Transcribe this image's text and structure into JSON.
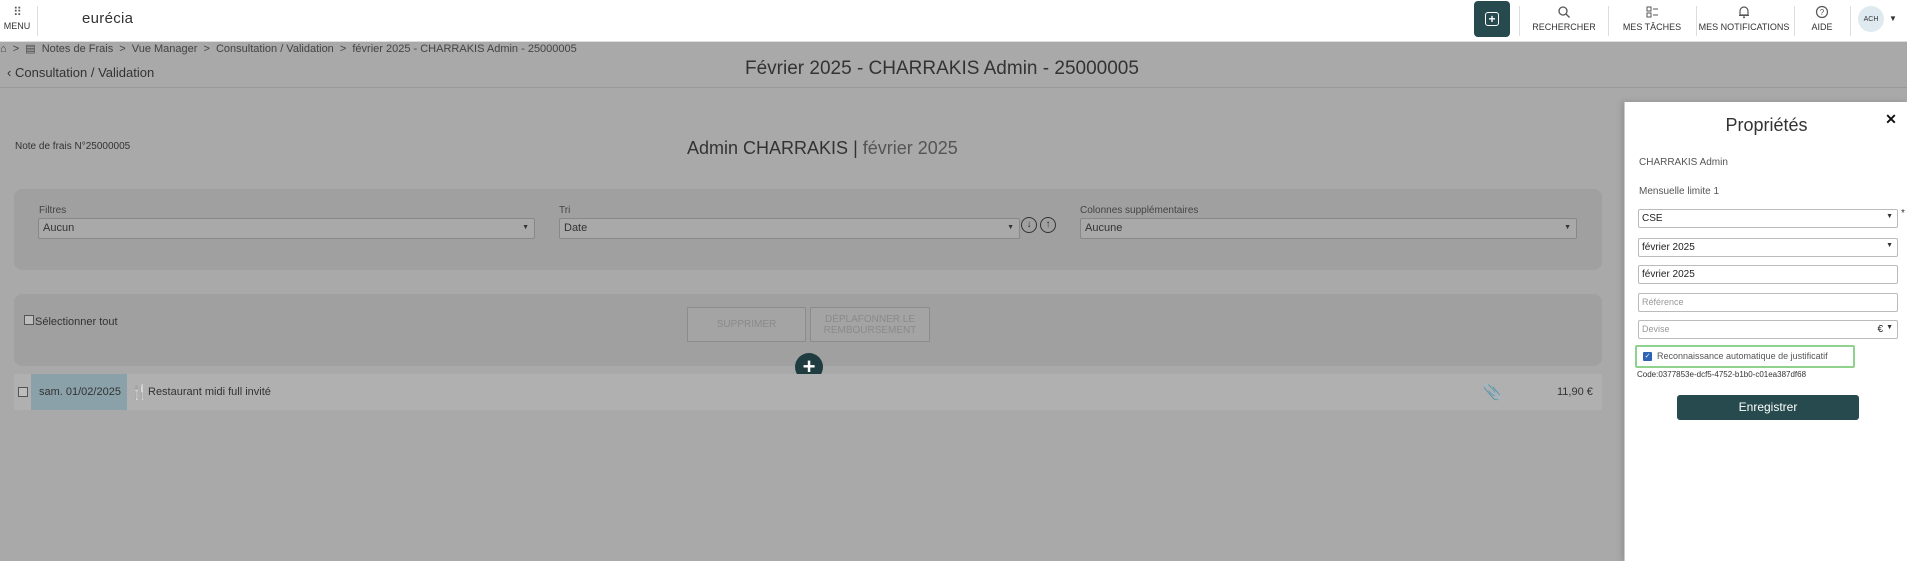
{
  "topbar": {
    "menu_label": "MENU",
    "logo": "eurécia",
    "items": [
      {
        "label": "RECHERCHER",
        "icon": "search-icon"
      },
      {
        "label": "MES TÂCHES",
        "icon": "tasks-icon"
      },
      {
        "label": "MES NOTIFICATIONS",
        "icon": "bell-icon"
      },
      {
        "label": "AIDE",
        "icon": "help-icon"
      }
    ],
    "avatar": "ACH"
  },
  "breadcrumb": [
    "Notes de Frais",
    ">",
    "Vue Manager",
    ">",
    "Consultation / Validation",
    ">",
    "février 2025 - CHARRAKIS Admin - 25000005"
  ],
  "back_link": "Consultation / Validation",
  "page_title": "Février 2025 - CHARRAKIS Admin - 25000005",
  "note": {
    "number_label": "Note de frais N°25000005",
    "name": "Admin CHARRAKIS",
    "separator": "|",
    "period": "février 2025"
  },
  "filters": {
    "filtres_label": "Filtres",
    "filtres_value": "Aucun",
    "tri_label": "Tri",
    "tri_value": "Date",
    "colonnes_label": "Colonnes supplémentaires",
    "colonnes_value": "Aucune"
  },
  "selection": {
    "select_all_label": "Sélectionner tout",
    "delete_label": "SUPPRIMER",
    "deplafonner_label": "DÉPLAFONNER LE REMBOURSEMENT"
  },
  "expenses": [
    {
      "date": "sam. 01/02/2025",
      "description": "Restaurant midi full invité",
      "amount": "11,90 €"
    }
  ],
  "panel": {
    "title": "Propriétés",
    "owner": "CHARRAKIS Admin",
    "limit": "Mensuelle limite 1",
    "category_value": "CSE",
    "period_select_value": "février 2025",
    "period_text_value": "février 2025",
    "reference_placeholder": "Référence",
    "devise_placeholder": "Devise",
    "devise_symbol": "€",
    "required_mark": "*",
    "reco_label": "Reconnaissance automatique de justificatif",
    "reco_checked": true,
    "code_label": "Code:",
    "code_value": "0377853e-dcf5-4752-b1b0-c01ea387df68",
    "save_label": "Enregistrer"
  },
  "colors": {
    "brand": "#264a4d",
    "overlay": "#a9a9a9",
    "highlight_green": "#8ed28e"
  }
}
